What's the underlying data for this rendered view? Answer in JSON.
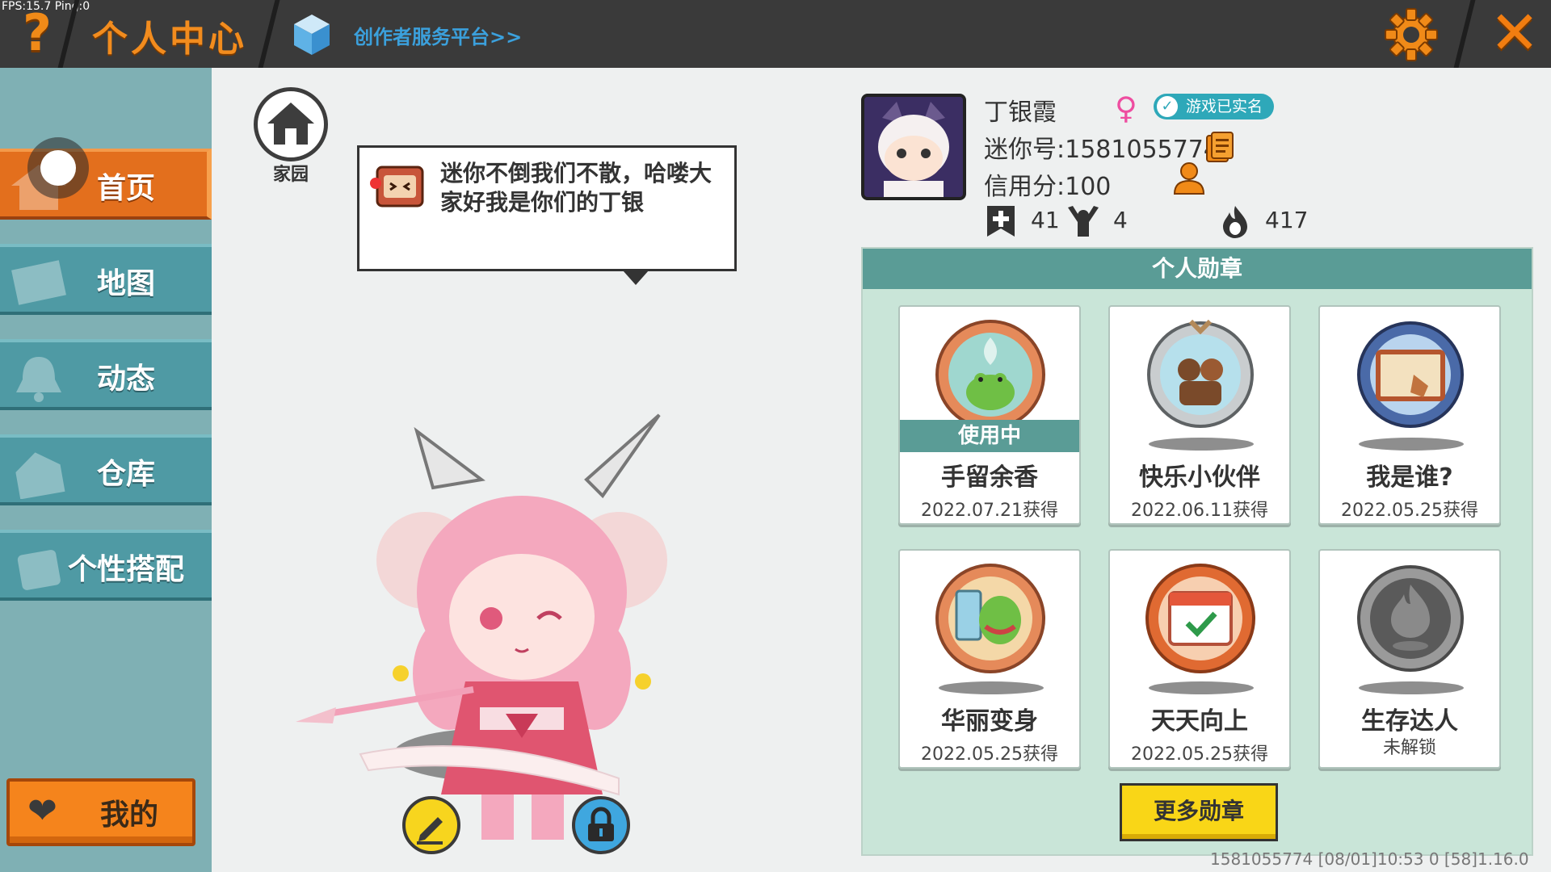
{
  "debug": {
    "fps_text": "FPS:15.7  Ping:0"
  },
  "header": {
    "title": "个人中心",
    "creator_link": "创作者服务平台>>",
    "icons": {
      "help": "question-mark-icon",
      "settings": "gear-icon",
      "close": "close-icon",
      "creator": "cube-icon"
    }
  },
  "sidebar": {
    "items": [
      {
        "label": "首页",
        "icon": "home-icon",
        "active": true
      },
      {
        "label": "地图",
        "icon": "map-icon",
        "active": false
      },
      {
        "label": "动态",
        "icon": "bell-icon",
        "active": false
      },
      {
        "label": "仓库",
        "icon": "warehouse-icon",
        "active": false
      },
      {
        "label": "个性搭配",
        "icon": "outfit-icon",
        "active": false
      }
    ],
    "mine_label": "我的"
  },
  "center": {
    "home_label": "家园",
    "bubble_text": "迷你不倒我们不散，哈喽大家好我是你们的丁银"
  },
  "profile": {
    "name": "丁银霞",
    "gender": "♀",
    "verified": "游戏已实名",
    "mini_id": "迷你号:1581055774",
    "credit": "信用分:100",
    "stats": [
      {
        "icon": "flag-icon",
        "value": "41"
      },
      {
        "icon": "cheer-icon",
        "value": "4"
      },
      {
        "icon": "flame-icon",
        "value": "417"
      }
    ]
  },
  "badges": {
    "title": "个人勋章",
    "in_use_label": "使用中",
    "items": [
      {
        "name": "手留余香",
        "date": "2022.07.21获得",
        "in_use": true
      },
      {
        "name": "快乐小伙伴",
        "date": "2022.06.11获得",
        "in_use": false
      },
      {
        "name": "我是谁?",
        "date": "2022.05.25获得",
        "in_use": false
      },
      {
        "name": "华丽变身",
        "date": "2022.05.25获得",
        "in_use": false
      },
      {
        "name": "天天向上",
        "date": "2022.05.25获得",
        "in_use": false
      },
      {
        "name": "生存达人",
        "date": "未解锁",
        "in_use": false
      }
    ],
    "more_label": "更多勋章"
  },
  "footer": {
    "info": "1581055774    [08/01]10:53 0  [58]1.16.0"
  },
  "colors": {
    "accent_orange": "#e36f1d",
    "teal": "#4f9aa4",
    "panel_green": "#c9e5d8",
    "yellow": "#f9d617"
  }
}
